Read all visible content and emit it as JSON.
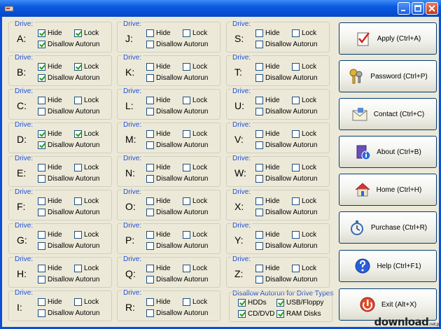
{
  "window": {
    "title": ""
  },
  "drive_group_title": "Drive:",
  "labels": {
    "hide": "Hide",
    "lock": "Lock",
    "disallow": "Disallow Autorun"
  },
  "drives": [
    {
      "letter": "A:",
      "hide": true,
      "lock": true,
      "disallow": true
    },
    {
      "letter": "B:",
      "hide": true,
      "lock": true,
      "disallow": true
    },
    {
      "letter": "C:",
      "hide": false,
      "lock": false,
      "disallow": false
    },
    {
      "letter": "D:",
      "hide": true,
      "lock": true,
      "disallow": true
    },
    {
      "letter": "E:",
      "hide": false,
      "lock": false,
      "disallow": false
    },
    {
      "letter": "F:",
      "hide": false,
      "lock": false,
      "disallow": false
    },
    {
      "letter": "G:",
      "hide": false,
      "lock": false,
      "disallow": false
    },
    {
      "letter": "H:",
      "hide": false,
      "lock": false,
      "disallow": false
    },
    {
      "letter": "I:",
      "hide": false,
      "lock": false,
      "disallow": false
    },
    {
      "letter": "J:",
      "hide": false,
      "lock": false,
      "disallow": false
    },
    {
      "letter": "K:",
      "hide": false,
      "lock": false,
      "disallow": false
    },
    {
      "letter": "L:",
      "hide": false,
      "lock": false,
      "disallow": false
    },
    {
      "letter": "M:",
      "hide": false,
      "lock": false,
      "disallow": false
    },
    {
      "letter": "N:",
      "hide": false,
      "lock": false,
      "disallow": false
    },
    {
      "letter": "O:",
      "hide": false,
      "lock": false,
      "disallow": false
    },
    {
      "letter": "P:",
      "hide": false,
      "lock": false,
      "disallow": false
    },
    {
      "letter": "Q:",
      "hide": false,
      "lock": false,
      "disallow": false
    },
    {
      "letter": "R:",
      "hide": false,
      "lock": false,
      "disallow": false
    },
    {
      "letter": "S:",
      "hide": false,
      "lock": false,
      "disallow": false
    },
    {
      "letter": "T:",
      "hide": false,
      "lock": false,
      "disallow": false
    },
    {
      "letter": "U:",
      "hide": false,
      "lock": false,
      "disallow": false
    },
    {
      "letter": "V:",
      "hide": false,
      "lock": false,
      "disallow": false
    },
    {
      "letter": "W:",
      "hide": false,
      "lock": false,
      "disallow": false
    },
    {
      "letter": "X:",
      "hide": false,
      "lock": false,
      "disallow": false
    },
    {
      "letter": "Y:",
      "hide": false,
      "lock": false,
      "disallow": false
    },
    {
      "letter": "Z:",
      "hide": false,
      "lock": false,
      "disallow": false
    }
  ],
  "drive_types": {
    "title": "Disallow Autorun for Drive Types",
    "items": [
      {
        "label": "HDDs",
        "checked": true
      },
      {
        "label": "USB/Floppy",
        "checked": true
      },
      {
        "label": "CD/DVD",
        "checked": true
      },
      {
        "label": "RAM Disks",
        "checked": true
      }
    ]
  },
  "buttons": [
    {
      "id": "apply",
      "label": "Apply (Ctrl+A)",
      "icon": "apply-checklist-icon"
    },
    {
      "id": "password",
      "label": "Password (Ctrl+P)",
      "icon": "keys-icon"
    },
    {
      "id": "contact",
      "label": "Contact (Ctrl+C)",
      "icon": "mail-icon"
    },
    {
      "id": "about",
      "label": "About (Ctrl+B)",
      "icon": "info-book-icon"
    },
    {
      "id": "home",
      "label": "Home (Ctrl+H)",
      "icon": "house-icon"
    },
    {
      "id": "purchase",
      "label": "Purchase (Ctrl+R)",
      "icon": "stopwatch-icon"
    },
    {
      "id": "help",
      "label": "Help (Ctrl+F1)",
      "icon": "help-icon"
    },
    {
      "id": "exit",
      "label": "Exit (Alt+X)",
      "icon": "power-icon"
    }
  ],
  "watermark": {
    "text": "download",
    "suffix": ".net.pl"
  },
  "colors": {
    "titlebar": "#0a5ae0",
    "group_title": "#1f4fd8",
    "check": "#21a121",
    "face": "#ece9d8"
  }
}
